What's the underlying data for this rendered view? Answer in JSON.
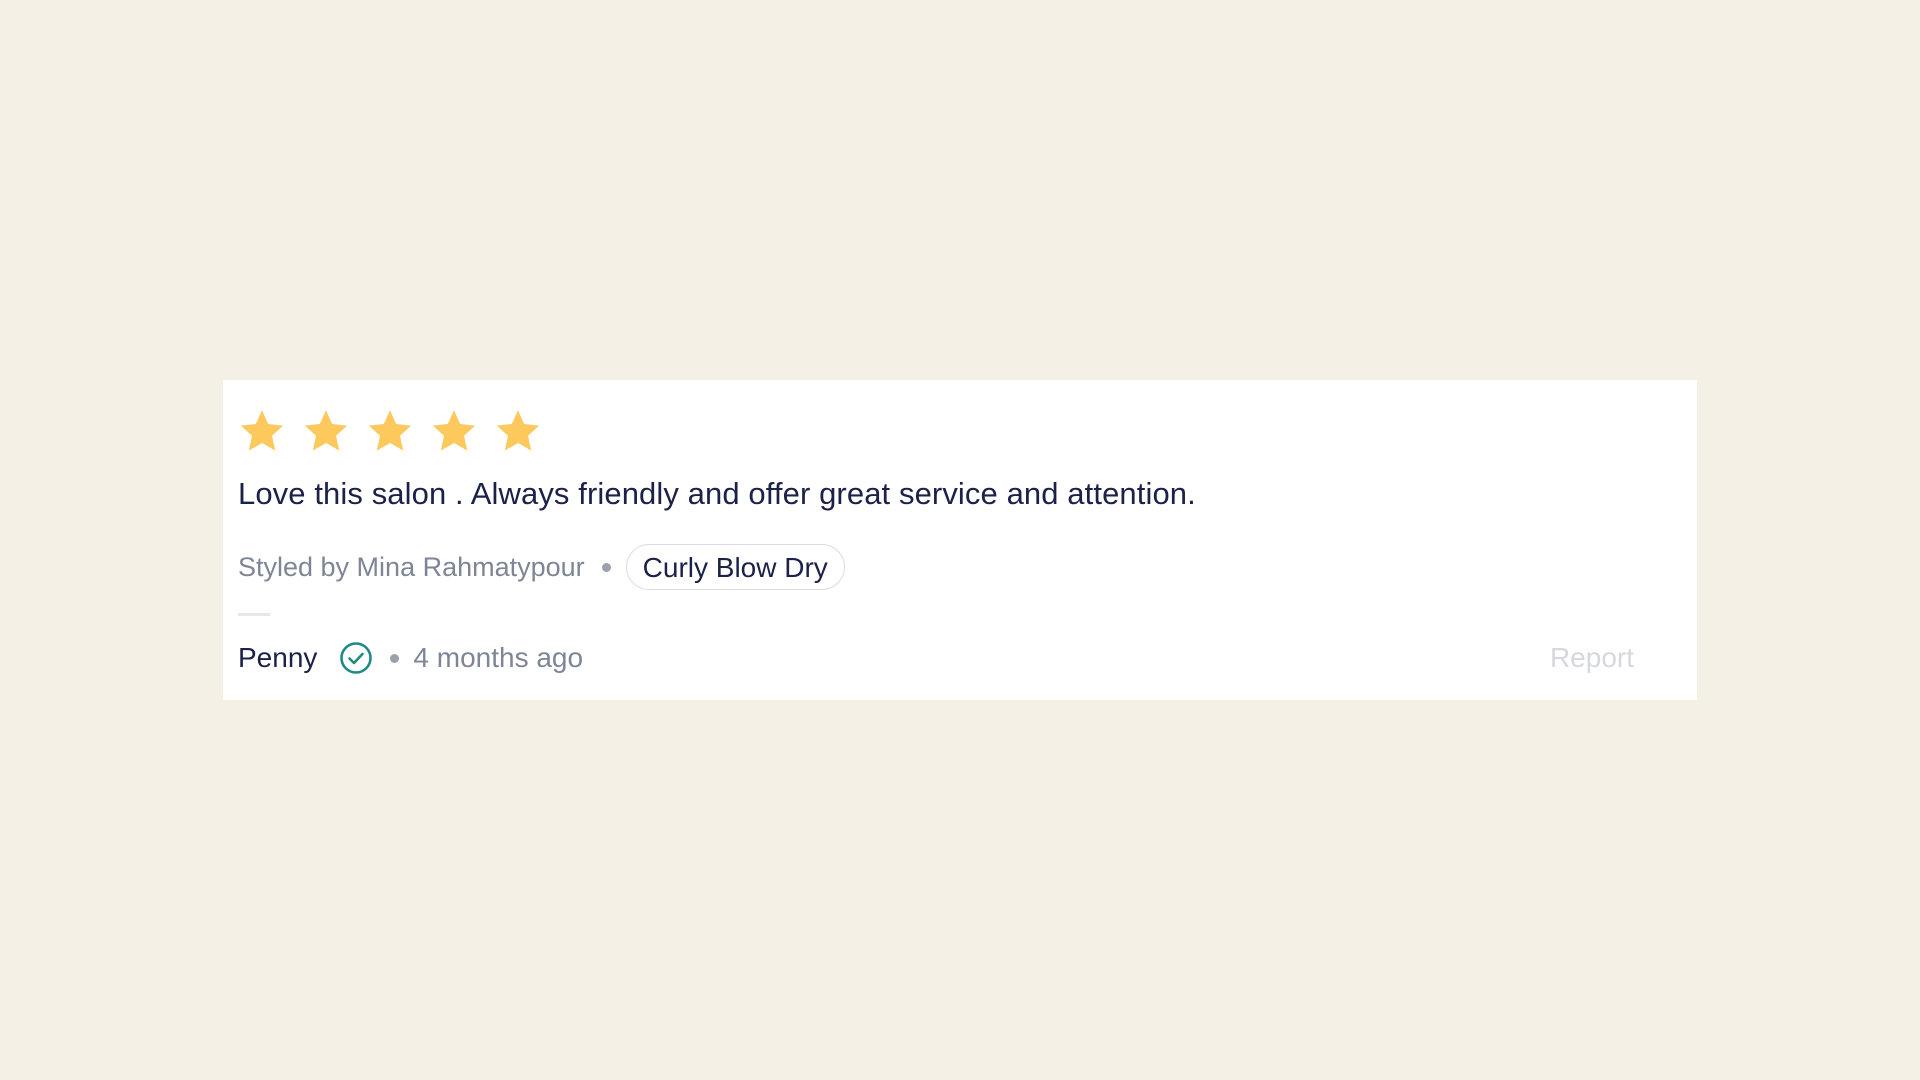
{
  "review": {
    "rating": 5,
    "max_rating": 5,
    "star_color": "#fdc95c",
    "text": "Love this salon . Always friendly and offer great service and attention.",
    "stylist": "Styled by Mina Rahmatypour",
    "service_tag": "Curly Blow Dry",
    "author": "Penny",
    "verified_icon": "check-circle-icon",
    "verified_color": "#1f8a80",
    "time_ago": "4 months ago",
    "report_label": "Report"
  }
}
